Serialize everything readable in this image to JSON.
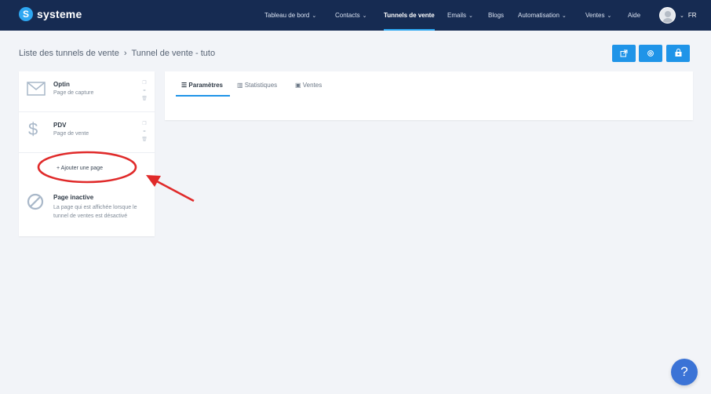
{
  "brand": {
    "name": "systeme"
  },
  "nav": {
    "items": [
      {
        "label": "Tableau de bord",
        "caret": "⌄"
      },
      {
        "label": "Contacts",
        "caret": "⌄"
      },
      {
        "label": "Tunnels de vente",
        "caret": ""
      },
      {
        "label": "Emails",
        "caret": "⌄"
      },
      {
        "label": "Blogs",
        "caret": ""
      },
      {
        "label": "Automatisation",
        "caret": "⌄"
      },
      {
        "label": "Ventes",
        "caret": "⌄"
      },
      {
        "label": "Aide",
        "caret": ""
      }
    ],
    "active": "Tunnels de vente",
    "user_menu_caret": "⌄",
    "language": "FR"
  },
  "breadcrumb": {
    "parent": "Liste des tunnels de vente",
    "separator": "›",
    "current": "Tunnel de vente - tuto"
  },
  "actions": {
    "icons": [
      "external-link-icon",
      "settings-icon",
      "store-icon"
    ]
  },
  "pages": [
    {
      "title": "Optin",
      "subtitle": "Page de capture",
      "icon": "envelope-icon"
    },
    {
      "title": "PDV",
      "subtitle": "Page de vente",
      "icon": "dollar-icon"
    }
  ],
  "add_page": {
    "label": "+  Ajouter une page"
  },
  "inactive_page": {
    "title": "Page inactive",
    "description": "La page qui est affichée lorsque le tunnel de ventes est désactivé",
    "icon": "forbidden-icon"
  },
  "tabs": [
    {
      "label": "Paramètres",
      "icon": "list-icon",
      "active": true
    },
    {
      "label": "Statistiques",
      "icon": "bar-chart-icon",
      "active": false
    },
    {
      "label": "Ventes",
      "icon": "money-icon",
      "active": false
    }
  ],
  "help": {
    "label": "?"
  },
  "colors": {
    "topbar": "#162b52",
    "accent": "#1f94e8",
    "annotation": "#e02a2a",
    "background": "#f2f4f8"
  }
}
